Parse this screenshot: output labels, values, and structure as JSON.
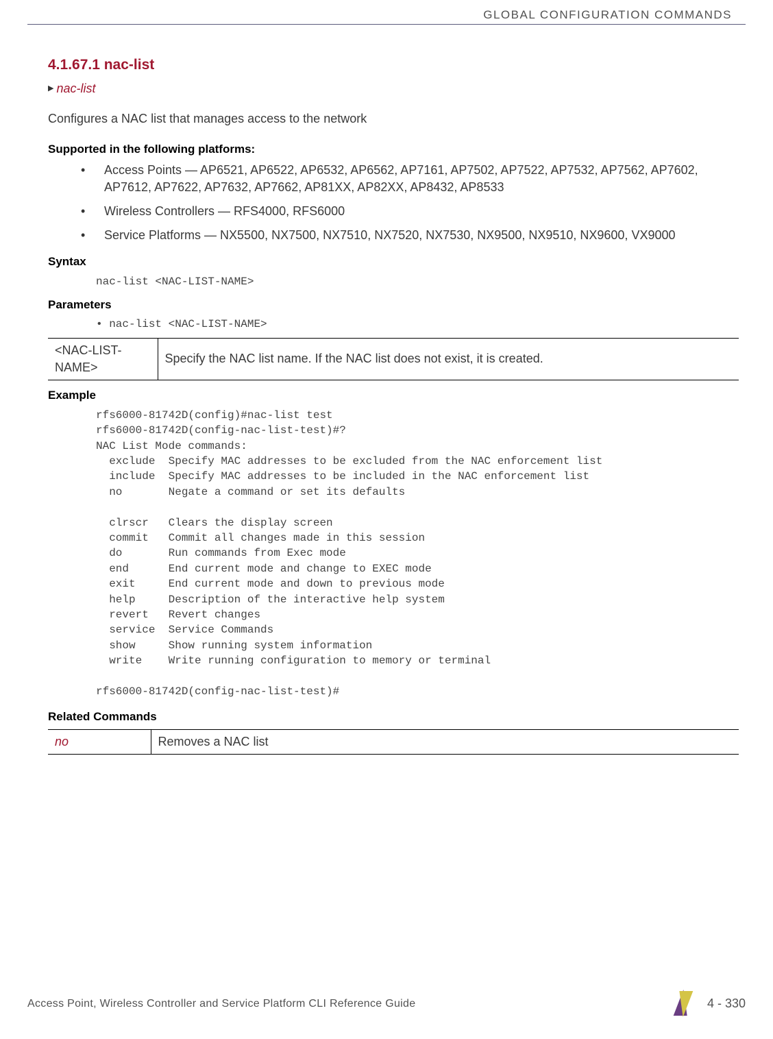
{
  "header": {
    "doc_section": "GLOBAL CONFIGURATION COMMANDS"
  },
  "section": {
    "number_title": "4.1.67.1 nac-list",
    "nav_arrow": "▶",
    "nav_text": "nac-list",
    "intro": "Configures a NAC list that manages access to the network"
  },
  "supported": {
    "heading": "Supported in the following platforms:",
    "items": [
      "Access Points — AP6521, AP6522, AP6532, AP6562, AP7161, AP7502, AP7522, AP7532, AP7562, AP7602, AP7612, AP7622, AP7632, AP7662, AP81XX, AP82XX, AP8432, AP8533",
      "Wireless Controllers — RFS4000, RFS6000",
      "Service Platforms — NX5500, NX7500, NX7510, NX7520, NX7530, NX9500, NX9510, NX9600, VX9000"
    ]
  },
  "syntax": {
    "heading": "Syntax",
    "code": "nac-list <NAC-LIST-NAME>"
  },
  "parameters": {
    "heading": "Parameters",
    "bullet_line": "• nac-list <NAC-LIST-NAME>",
    "table": {
      "left": "<NAC-LIST-NAME>",
      "right": "Specify the NAC list name. If the NAC list does not exist, it is created."
    }
  },
  "example": {
    "heading": "Example",
    "code": "rfs6000-81742D(config)#nac-list test\nrfs6000-81742D(config-nac-list-test)#?\nNAC List Mode commands:\n  exclude  Specify MAC addresses to be excluded from the NAC enforcement list\n  include  Specify MAC addresses to be included in the NAC enforcement list\n  no       Negate a command or set its defaults\n\n  clrscr   Clears the display screen\n  commit   Commit all changes made in this session\n  do       Run commands from Exec mode\n  end      End current mode and change to EXEC mode\n  exit     End current mode and down to previous mode\n  help     Description of the interactive help system\n  revert   Revert changes\n  service  Service Commands\n  show     Show running system information\n  write    Write running configuration to memory or terminal\n\nrfs6000-81742D(config-nac-list-test)#"
  },
  "related": {
    "heading": "Related Commands",
    "table": {
      "left": "no",
      "right": "Removes a NAC list"
    }
  },
  "footer": {
    "guide": "Access Point, Wireless Controller and Service Platform CLI Reference Guide",
    "page": "4 - 330"
  }
}
